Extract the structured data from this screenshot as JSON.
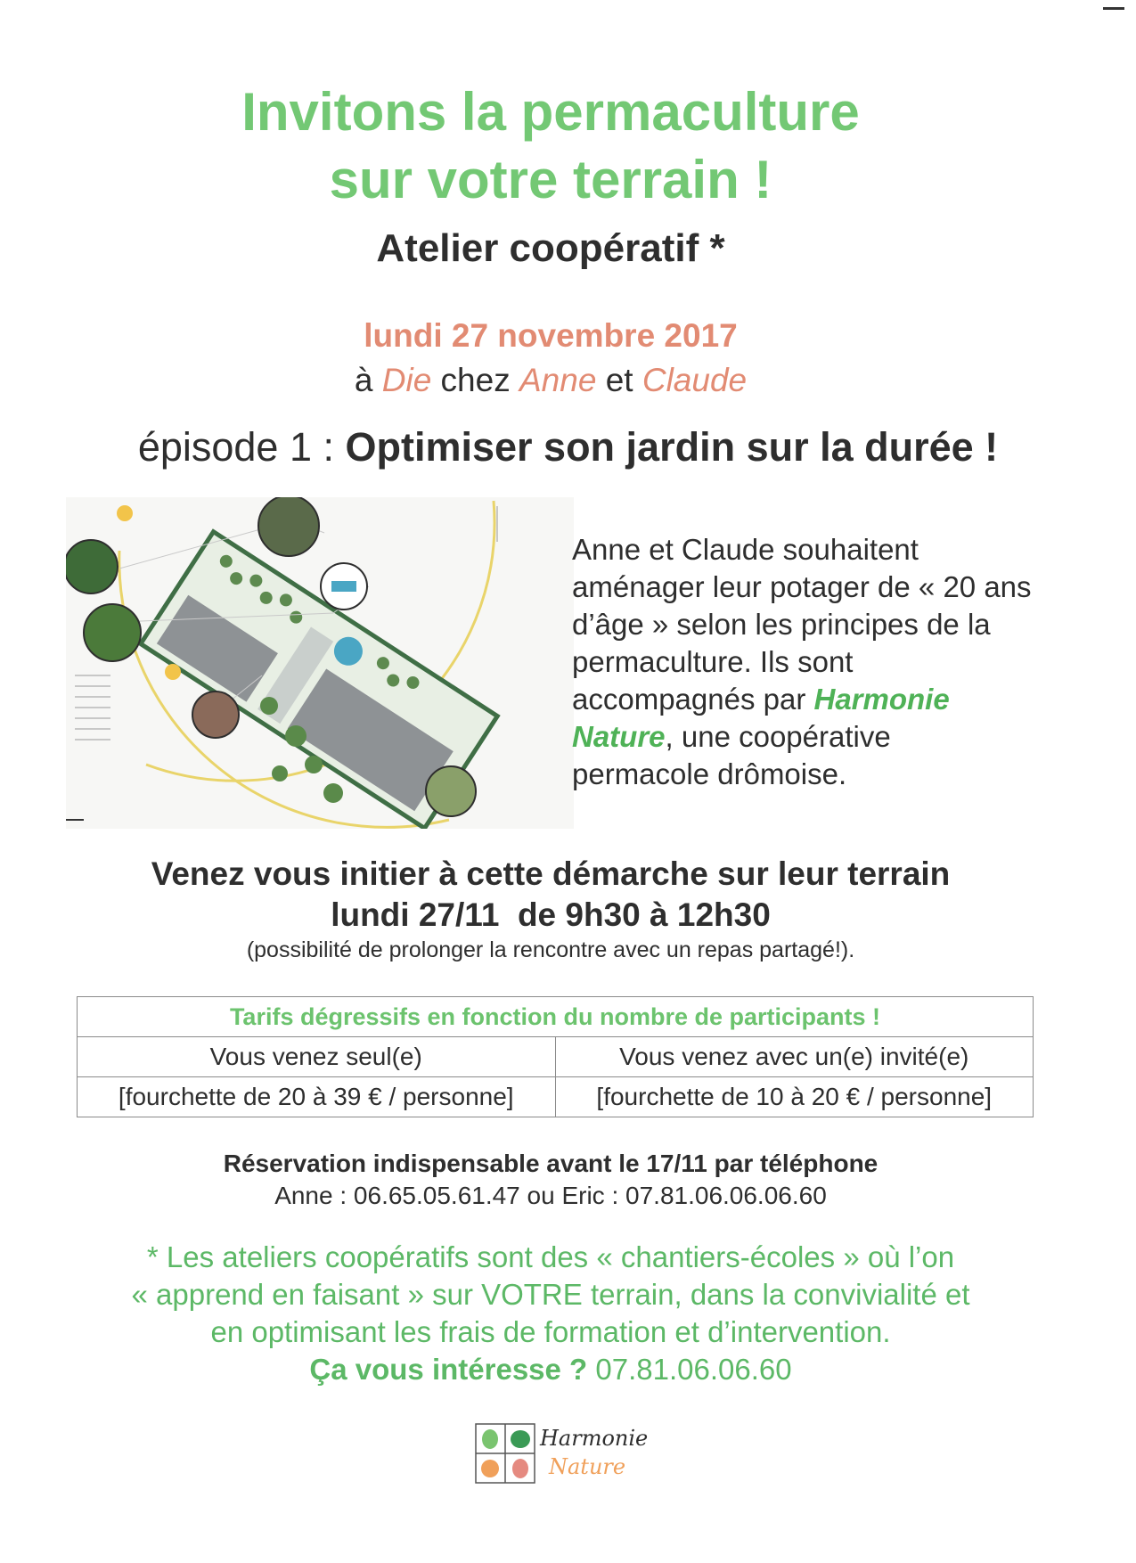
{
  "header": {
    "title_line1": "Invitons la permaculture",
    "title_line2": "sur votre terrain !",
    "subtitle": "Atelier coopératif *"
  },
  "event": {
    "date": "lundi 27 novembre 2017",
    "place_prefix": "à ",
    "place_city": "Die",
    "place_mid": " chez ",
    "place_host1": "Anne",
    "place_and": " et ",
    "place_host2": "Claude",
    "episode_label": "épisode 1 : ",
    "episode_title": "Optimiser son jardin sur la durée !"
  },
  "description": {
    "text_before": "Anne et Claude souhaitent aménager leur potager de « 20 ans d’âge » selon les principes de la permaculture. Ils sont accompagnés par ",
    "org_name": "Harmonie Nature",
    "text_after": ", une coopérative permacole drômoise."
  },
  "invitation": {
    "line1": "Venez vous initier à cette démarche sur leur terrain",
    "line2": "lundi 27/11  de 9h30 à 12h30",
    "note": "(possibilité de prolonger la rencontre avec un repas partagé!)."
  },
  "pricing": {
    "header": "Tarifs dégressifs en fonction du nombre de participants !",
    "col1_label": "Vous venez seul(e)",
    "col2_label": "Vous venez avec un(e) invité(e)",
    "col1_price": "[fourchette de 20 à 39 € / personne]",
    "col2_price": "[fourchette de 10 à 20 € / personne]"
  },
  "reservation": {
    "title": "Réservation indispensable avant le 17/11 par téléphone",
    "contacts": "Anne : 06.65.05.61.47 ou Eric : 07.81.06.06.06.60"
  },
  "footnote": {
    "line1": "* Les ateliers coopératifs sont des « chantiers-écoles » où l’on",
    "line2": "« apprend en faisant » sur VOTRE terrain, dans la convivialité et",
    "line3": "en optimisant les frais de formation et d’intervention.",
    "question": "Ça vous intéresse ?",
    "phone": " 07.81.06.06.60"
  },
  "logo": {
    "line1": "Harmonie",
    "line2": "Nature"
  },
  "colors": {
    "title_green": "#73c874",
    "accent_salmon": "#e28b73",
    "org_green": "#4fb257",
    "logo_dark_green": "#3a9a55",
    "logo_light_green": "#7ac46f",
    "logo_orange": "#f0a05a",
    "logo_pink": "#e58a80"
  }
}
